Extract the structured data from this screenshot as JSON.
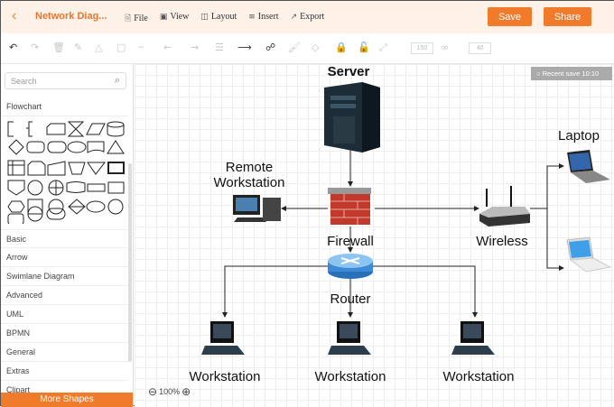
{
  "header": {
    "title": "Network Diag...",
    "menu": [
      "File",
      "View",
      "Layout",
      "Insert",
      "Export"
    ],
    "menu_icons": [
      "file-icon",
      "view-icon",
      "layout-icon",
      "insert-icon",
      "export-icon"
    ],
    "save": "Save",
    "share": "Share"
  },
  "toolbar": {
    "font_size": "150",
    "line_width": "40"
  },
  "sidebar": {
    "search_placeholder": "Search",
    "sections": [
      "Flowchart",
      "Basic",
      "Arrow",
      "Swimlane Diagram",
      "Advanced",
      "UML",
      "BPMN",
      "General",
      "Extras",
      "Clipart"
    ],
    "more_shapes": "More Shapes"
  },
  "canvas": {
    "recent_save": "Recent save 10:10",
    "zoom": "100%",
    "labels": {
      "server": "Server",
      "remote1": "Remote",
      "remote2": "Workstation",
      "firewall": "Firewall",
      "wireless": "Wireless",
      "laptop": "Laptop",
      "router": "Router",
      "ws1": "Workstation",
      "ws2": "Workstation",
      "ws3": "Workstation"
    }
  },
  "colors": {
    "accent": "#f07b2b",
    "header_bg": "#fdf1e8"
  }
}
